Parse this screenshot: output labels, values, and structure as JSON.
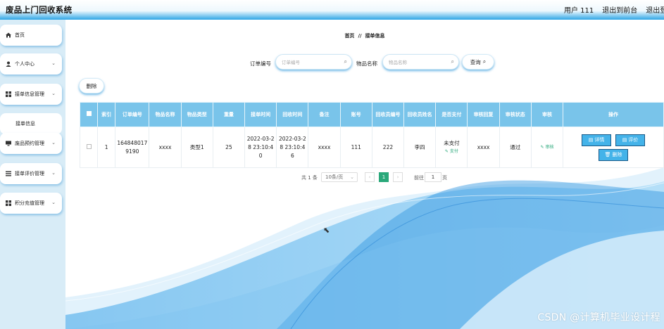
{
  "header": {
    "title": "废品上门回收系统",
    "user": "用户 111",
    "front_link": "退出到前台",
    "logout": "退出登录"
  },
  "sidebar": {
    "items": [
      {
        "label": "首页",
        "icon": "home-icon"
      },
      {
        "label": "个人中心",
        "icon": "user-icon"
      },
      {
        "label": "接单信息管理",
        "icon": "grid-icon"
      },
      {
        "label": "废品预约管理",
        "icon": "monitor-icon"
      },
      {
        "label": "接单评价管理",
        "icon": "list-icon"
      },
      {
        "label": "积分充值管理",
        "icon": "grid-icon"
      }
    ],
    "sub_item": "接单信息"
  },
  "breadcrumb": {
    "home": "首页",
    "separator": "//",
    "current": "接单信息"
  },
  "search": {
    "order_label": "订单编号",
    "order_placeholder": "订单编号",
    "item_label": "物品名称",
    "item_placeholder": "物品名称",
    "query_button": "查询"
  },
  "actions": {
    "delete_button": "删除"
  },
  "table": {
    "columns": [
      "索引",
      "订单编号",
      "物品名称",
      "物品类型",
      "重量",
      "接单时间",
      "回收时间",
      "备注",
      "账号",
      "回收员编号",
      "回收员姓名",
      "是否支付",
      "审核回复",
      "审核状态",
      "审核",
      "操作"
    ],
    "rows": [
      {
        "index": "1",
        "order_no": "1648480179190",
        "item_name": "xxxx",
        "item_type": "类型1",
        "weight": "25",
        "accept_time": "2022-03-28 23:10:40",
        "recycle_time": "2022-03-28 23:10:46",
        "remark": "xxxx",
        "account": "111",
        "collector_no": "222",
        "collector_name": "李四",
        "paid": "未支付",
        "pay_link": "支付",
        "review_reply": "xxxx",
        "review_status": "通过",
        "review_link": "审核",
        "btn_detail": "详情",
        "btn_rate": "评价",
        "btn_delete": "删除"
      }
    ]
  },
  "pager": {
    "total": "共 1 条",
    "page_size": "10条/页",
    "current_page": "1",
    "goto_label": "前往",
    "goto_value": "1",
    "goto_suffix": "页"
  },
  "watermark": "CSDN @计算机毕业设计程",
  "colors": {
    "accent": "#44b3e9",
    "header_bg": "#79c4ea",
    "sidebar_bg": "#d8ecf7"
  }
}
